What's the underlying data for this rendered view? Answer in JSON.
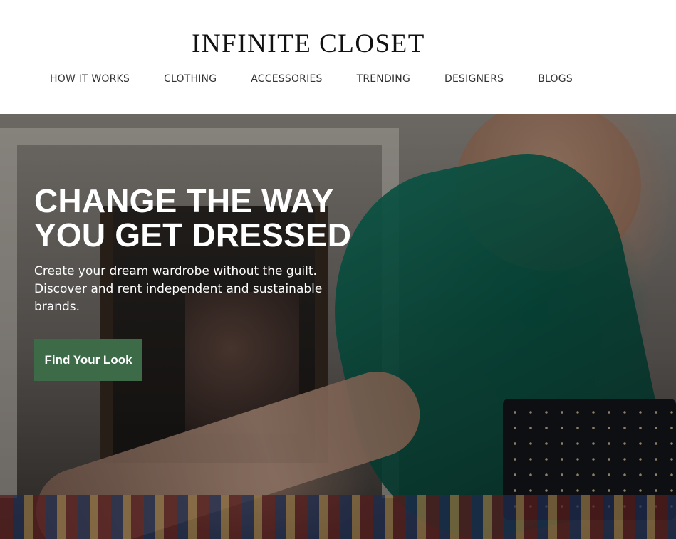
{
  "brand": {
    "logo_text": "INFINITE CLOSET"
  },
  "nav": {
    "items": [
      {
        "label": "HOW IT WORKS"
      },
      {
        "label": "CLOTHING"
      },
      {
        "label": "ACCESSORIES"
      },
      {
        "label": "TRENDING"
      },
      {
        "label": "DESIGNERS"
      },
      {
        "label": "BLOGS"
      }
    ]
  },
  "hero": {
    "title_line1": "CHANGE THE WAY",
    "title_line2": "YOU GET DRESSED",
    "subtitle": "Create your dream wardrobe without the guilt. Discover and rent independent and sustainable brands.",
    "cta_label": "Find Your Look",
    "image_subject": "woman-in-green-satin-slip-dress-by-fireplace"
  },
  "colors": {
    "cta_background": "#3d6b47",
    "hero_text": "#ffffff",
    "header_background": "#ffffff",
    "nav_text": "#333333"
  }
}
